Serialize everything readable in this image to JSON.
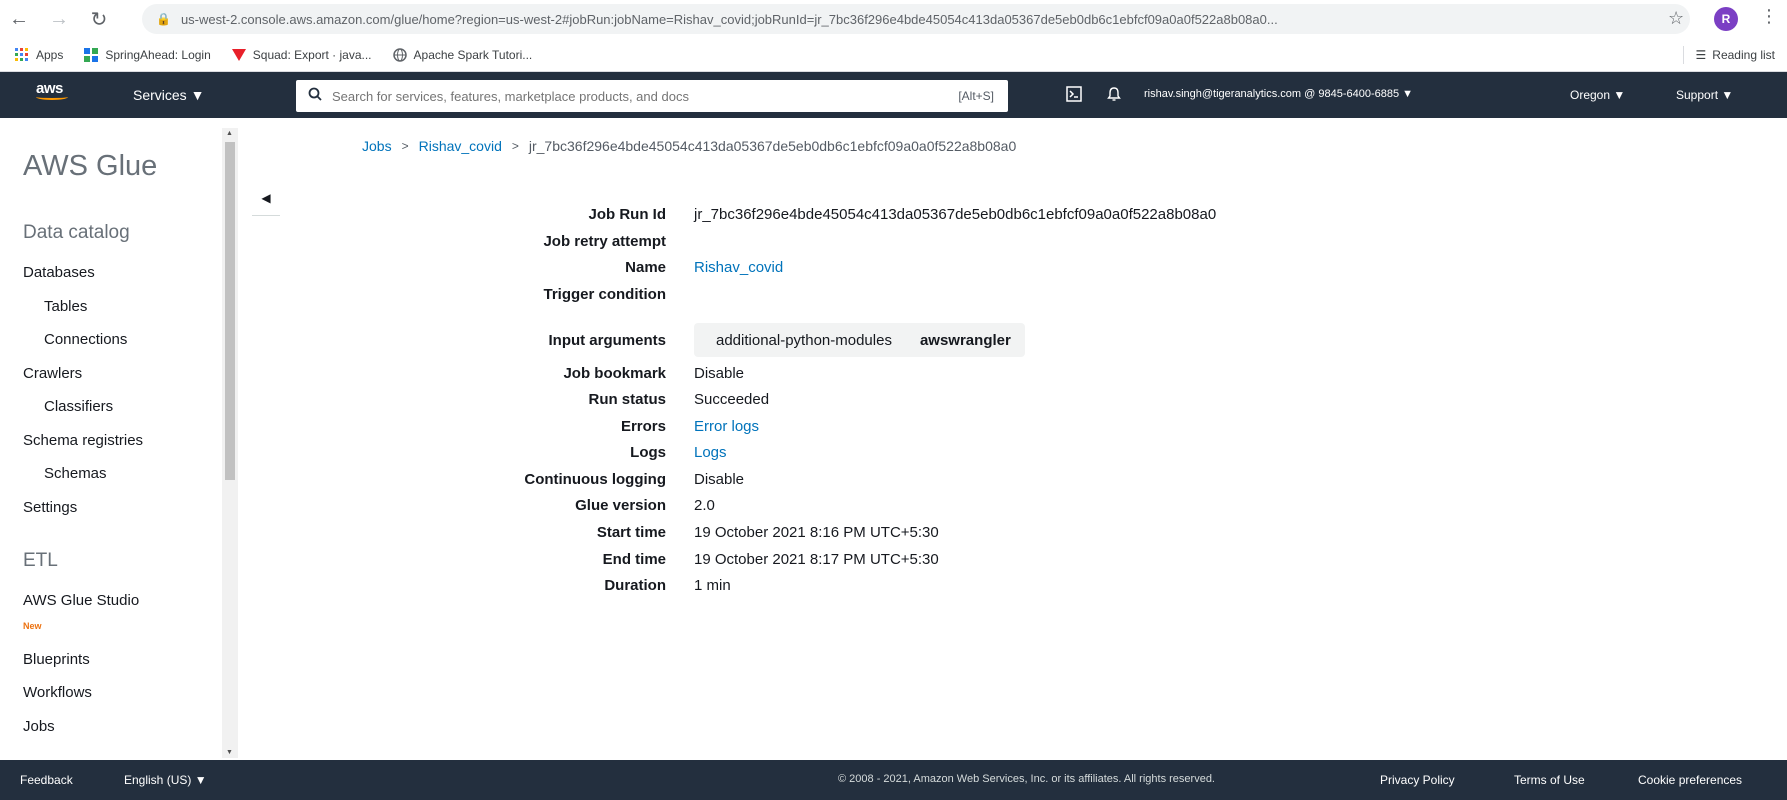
{
  "browser": {
    "url": "us-west-2.console.aws.amazon.com/glue/home?region=us-west-2#jobRun:jobName=Rishav_covid;jobRunId=jr_7bc36f296e4bde45054c413da05367de5eb0db6c1ebfcf09a0a0f522a8b08a0...",
    "bookmarks": [
      "Apps",
      "SpringAhead: Login",
      "Squad: Export · java...",
      "Apache Spark Tutori..."
    ],
    "reading_list": "Reading list",
    "profile_initial": "R"
  },
  "aws_header": {
    "logo": "aws",
    "services": "Services ▼",
    "search_placeholder": "Search for services, features, marketplace products, and docs",
    "search_shortcut": "[Alt+S]",
    "account": "rishav.singh@tigeranalytics.com @ 9845-6400-6885 ▼",
    "region": "Oregon ▼",
    "support": "Support ▼"
  },
  "sidebar": {
    "title": "AWS Glue",
    "sections": {
      "data_catalog": "Data catalog",
      "etl": "ETL"
    },
    "items": {
      "databases": "Databases",
      "tables": "Tables",
      "connections": "Connections",
      "crawlers": "Crawlers",
      "classifiers": "Classifiers",
      "schema_registries": "Schema registries",
      "schemas": "Schemas",
      "settings": "Settings",
      "glue_studio": "AWS Glue Studio",
      "glue_studio_badge": "New",
      "blueprints": "Blueprints",
      "workflows": "Workflows",
      "jobs": "Jobs"
    }
  },
  "breadcrumb": {
    "jobs": "Jobs",
    "job": "Rishav_covid",
    "run": "jr_7bc36f296e4bde45054c413da05367de5eb0db6c1ebfcf09a0a0f522a8b08a0"
  },
  "details": {
    "job_run_id": {
      "label": "Job Run Id",
      "value": "jr_7bc36f296e4bde45054c413da05367de5eb0db6c1ebfcf09a0a0f522a8b08a0"
    },
    "job_retry_attempt": {
      "label": "Job retry attempt",
      "value": ""
    },
    "name": {
      "label": "Name",
      "value": "Rishav_covid"
    },
    "trigger_condition": {
      "label": "Trigger condition",
      "value": ""
    },
    "input_arguments": {
      "label": "Input arguments",
      "key": "additional-python-modules",
      "value": "awswrangler"
    },
    "job_bookmark": {
      "label": "Job bookmark",
      "value": "Disable"
    },
    "run_status": {
      "label": "Run status",
      "value": "Succeeded"
    },
    "errors": {
      "label": "Errors",
      "value": "Error logs"
    },
    "logs": {
      "label": "Logs",
      "value": "Logs"
    },
    "continuous_logging": {
      "label": "Continuous logging",
      "value": "Disable"
    },
    "glue_version": {
      "label": "Glue version",
      "value": "2.0"
    },
    "start_time": {
      "label": "Start time",
      "value": "19 October 2021 8:16 PM UTC+5:30"
    },
    "end_time": {
      "label": "End time",
      "value": "19 October 2021 8:17 PM UTC+5:30"
    },
    "duration": {
      "label": "Duration",
      "value": "1 min"
    }
  },
  "footer": {
    "feedback": "Feedback",
    "language": "English (US) ▼",
    "copyright": "© 2008 - 2021, Amazon Web Services, Inc. or its affiliates. All rights reserved.",
    "privacy": "Privacy Policy",
    "terms": "Terms of Use",
    "cookies": "Cookie preferences"
  },
  "colors": {
    "aws_nav": "#232f3e",
    "aws_orange": "#ff9900",
    "link": "#0073bb"
  }
}
